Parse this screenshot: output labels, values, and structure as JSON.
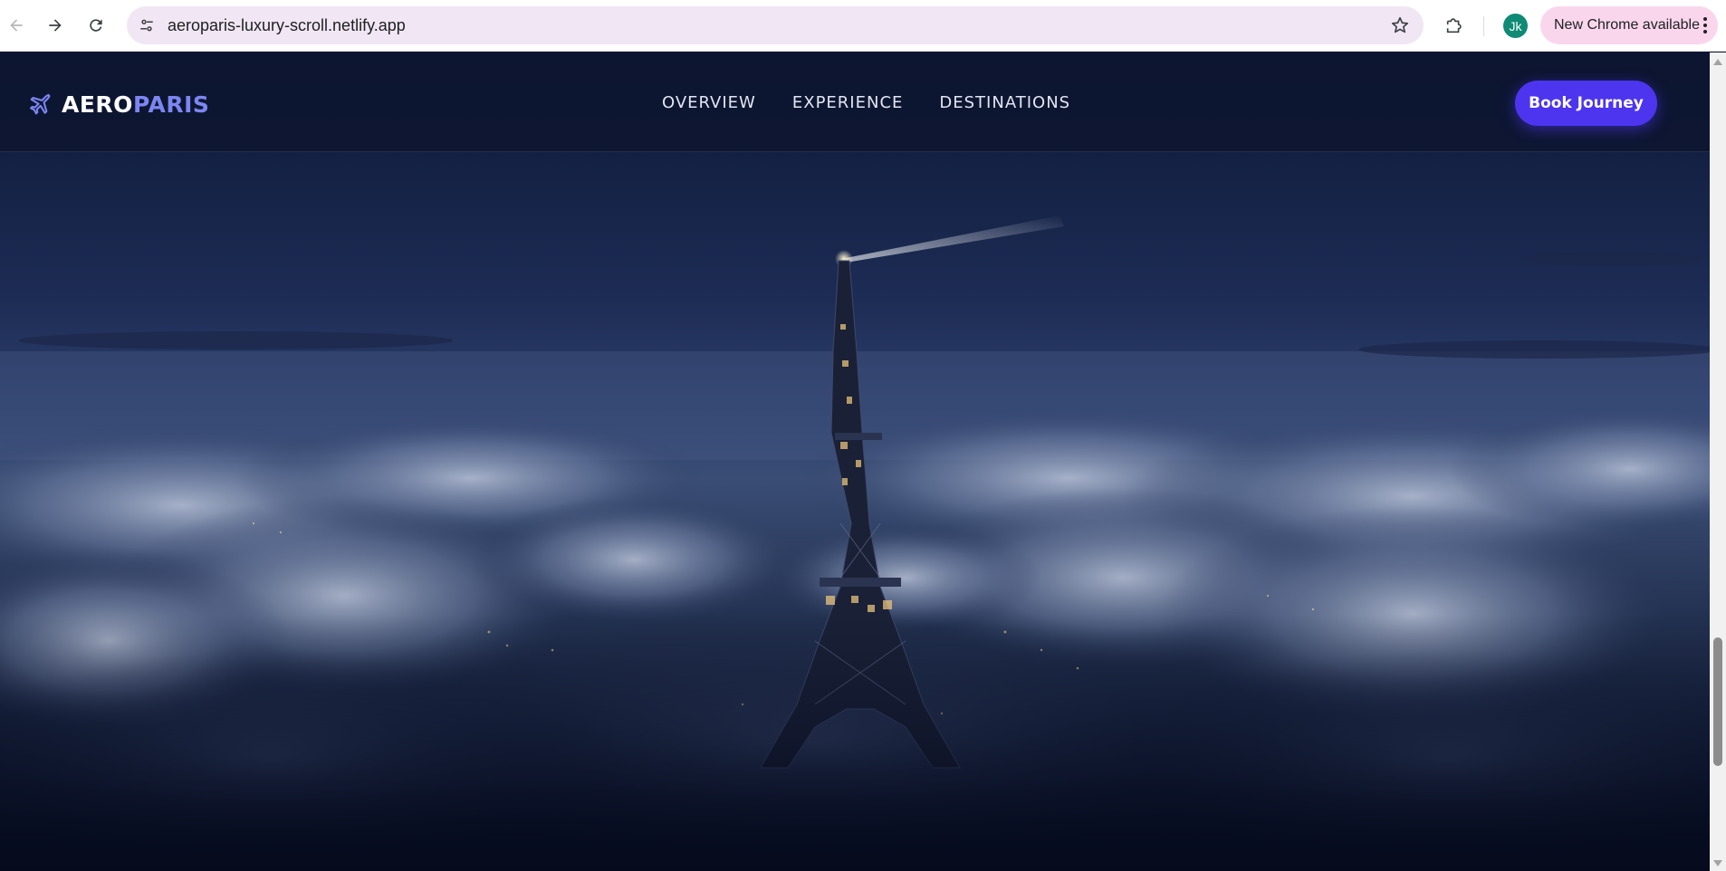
{
  "browser": {
    "url": "aeroparis-luxury-scroll.netlify.app",
    "profile_initials": "Jk",
    "update_label": "New Chrome available",
    "icons": {
      "back": "arrow-left-icon",
      "forward": "arrow-right-icon",
      "reload": "reload-icon",
      "site_info": "tune-icon",
      "bookmark": "star-icon",
      "extensions": "puzzle-icon",
      "menu": "kebab-menu-icon"
    }
  },
  "site": {
    "brand_part1": "AERO",
    "brand_part2": "PARIS",
    "brand_icon": "airplane-icon",
    "nav": [
      "OVERVIEW",
      "EXPERIENCE",
      "DESTINATIONS"
    ],
    "cta_label": "Book Journey",
    "colors": {
      "accent": "#7c86f2",
      "cta": "#4d35f0",
      "header_bg": "#0d142e"
    }
  },
  "hero": {
    "image_subject": "eiffel-tower-above-clouds-night"
  }
}
